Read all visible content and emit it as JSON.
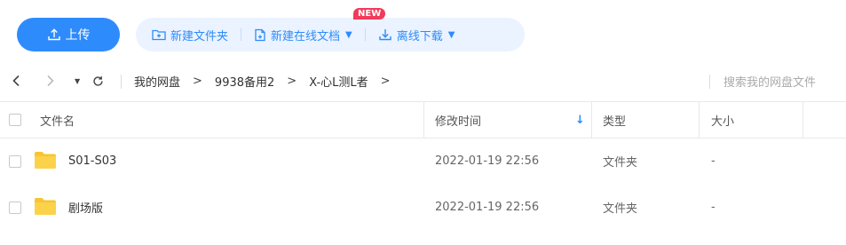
{
  "toolbar": {
    "upload_label": "上传",
    "new_folder_label": "新建文件夹",
    "new_online_doc_label": "新建在线文档",
    "new_badge": "NEW",
    "offline_download_label": "离线下载"
  },
  "navbar": {
    "breadcrumb": [
      "我的网盘",
      "9938备用2",
      "X-心L测L者"
    ],
    "search_placeholder": "搜索我的网盘文件"
  },
  "table": {
    "columns": {
      "name": "文件名",
      "modified": "修改时间",
      "type": "类型",
      "size": "大小"
    },
    "sort_indicator": "↓",
    "rows": [
      {
        "name": "S01-S03",
        "modified": "2022-01-19 22:56",
        "type": "文件夹",
        "size": "-"
      },
      {
        "name": "剧场版",
        "modified": "2022-01-19 22:56",
        "type": "文件夹",
        "size": "-"
      }
    ]
  },
  "colors": {
    "accent": "#2e8bfc",
    "accent_light": "#eaf3ff",
    "badge": "#f23a5a",
    "folder": "#f7c533"
  }
}
